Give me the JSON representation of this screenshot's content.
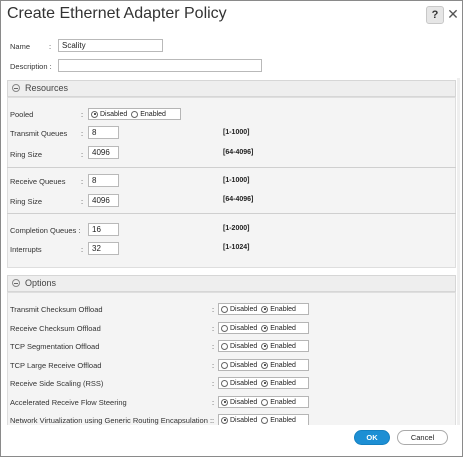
{
  "dialog": {
    "title": "Create Ethernet Adapter Policy",
    "help_label": "?",
    "close_label": "✕"
  },
  "general": {
    "name_label": "Name",
    "name_value": "Scality",
    "description_label": "Description :",
    "description_value": ""
  },
  "resources": {
    "header": "Resources",
    "pooled": {
      "label": "Pooled",
      "options": [
        "Disabled",
        "Enabled"
      ],
      "selected": "Disabled"
    },
    "groups": [
      [
        {
          "label": "Transmit Queues",
          "value": "8",
          "range": "[1-1000]"
        },
        {
          "label": "Ring Size",
          "value": "4096",
          "range": "[64-4096]"
        }
      ],
      [
        {
          "label": "Receive Queues",
          "value": "8",
          "range": "[1-1000]"
        },
        {
          "label": "Ring Size",
          "value": "4096",
          "range": "[64-4096]"
        }
      ],
      [
        {
          "label": "Completion Queues :",
          "value": "16",
          "range": "[1-2000]"
        },
        {
          "label": "Interrupts",
          "value": "32",
          "range": "[1-1024]"
        }
      ]
    ]
  },
  "options": {
    "header": "Options",
    "items": [
      {
        "label": "Transmit Checksum Offload",
        "selected": "Enabled"
      },
      {
        "label": "Receive Checksum Offload",
        "selected": "Enabled"
      },
      {
        "label": "TCP Segmentation Offload",
        "selected": "Enabled"
      },
      {
        "label": "TCP Large Receive Offload",
        "selected": "Enabled"
      },
      {
        "label": "Receive Side Scaling (RSS)",
        "selected": "Enabled"
      },
      {
        "label": "Accelerated Receive Flow Steering",
        "selected": "Disabled"
      },
      {
        "label": "Network Virtualization using Generic Routing Encapsulation :",
        "selected": "Disabled"
      }
    ],
    "option_labels": [
      "Disabled",
      "Enabled"
    ]
  },
  "footer": {
    "ok_label": "OK",
    "cancel_label": "Cancel"
  },
  "colors": {
    "primary_button": "#1d8fd4"
  }
}
